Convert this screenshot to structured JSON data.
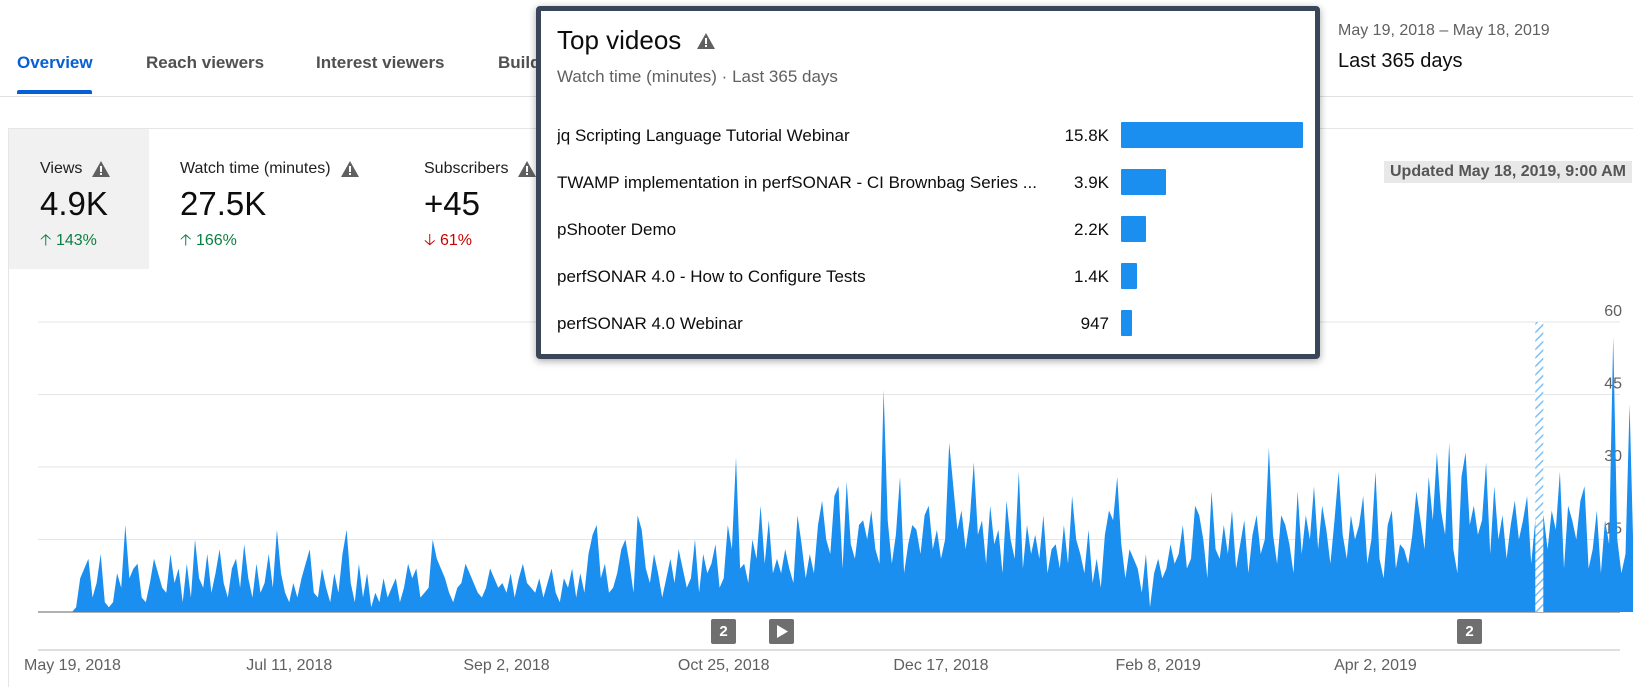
{
  "tabs": [
    {
      "label": "Overview",
      "active": true
    },
    {
      "label": "Reach viewers",
      "active": false
    },
    {
      "label": "Interest viewers",
      "active": false
    },
    {
      "label": "Build",
      "active": false
    }
  ],
  "date": {
    "range": "May 19, 2018 – May 18, 2019",
    "preset": "Last 365 days"
  },
  "metrics": [
    {
      "label": "Views",
      "value": "4.9K",
      "change": "143%",
      "direction": "up",
      "warning": true
    },
    {
      "label": "Watch time (minutes)",
      "value": "27.5K",
      "change": "166%",
      "direction": "up",
      "warning": true
    },
    {
      "label": "Subscribers",
      "value": "+45",
      "change": "61%",
      "direction": "down",
      "warning": true
    }
  ],
  "updated": "Updated May 18, 2019, 9:00 AM",
  "markers": [
    "2",
    "2"
  ],
  "top_videos": {
    "title": "Top videos",
    "subtitle": "Watch time (minutes) · Last 365 days",
    "items": [
      {
        "title": "jq Scripting Language Tutorial Webinar",
        "value_label": "15.8K",
        "value": 15800
      },
      {
        "title": "TWAMP implementation in perfSONAR - CI Brownbag Series ...",
        "value_label": "3.9K",
        "value": 3900
      },
      {
        "title": "pShooter Demo",
        "value_label": "2.2K",
        "value": 2200
      },
      {
        "title": "perfSONAR 4.0 - How to Configure Tests",
        "value_label": "1.4K",
        "value": 1400
      },
      {
        "title": "perfSONAR 4.0 Webinar",
        "value_label": "947",
        "value": 947
      }
    ]
  },
  "colors": {
    "accent": "#065fd4",
    "area": "#1a8ff0",
    "up": "#0b8043",
    "down": "#cc0000",
    "popup_border": "#394558"
  },
  "chart_data": {
    "type": "area",
    "ylim": [
      0,
      60
    ],
    "yticks": [
      0,
      15,
      30,
      45,
      60
    ],
    "x_tick_labels": [
      "May 19, 2018",
      "Jul 11, 2018",
      "Sep 2, 2018",
      "Oct 25, 2018",
      "Dec 17, 2018",
      "Feb 8, 2019",
      "Apr 2, 2019"
    ],
    "x_tick_days": [
      0,
      53,
      106,
      159,
      212,
      265,
      318
    ],
    "grid": true,
    "series": [
      {
        "values": [
          0,
          1,
          7,
          9,
          11,
          3,
          6,
          12,
          2,
          1,
          2,
          8,
          5,
          18,
          7,
          9,
          10,
          3,
          2,
          6,
          11,
          8,
          5,
          4,
          12,
          6,
          9,
          2,
          10,
          3,
          15,
          7,
          5,
          12,
          4,
          8,
          13,
          6,
          3,
          9,
          11,
          5,
          14,
          7,
          3,
          10,
          4,
          6,
          12,
          5,
          17,
          8,
          4,
          2,
          6,
          3,
          7,
          10,
          13,
          4,
          3,
          9,
          5,
          2,
          8,
          4,
          12,
          17,
          6,
          2,
          10,
          3,
          8,
          1,
          4,
          2,
          7,
          3,
          5,
          7,
          2,
          5,
          10,
          7,
          9,
          3,
          4,
          5,
          15,
          11,
          9,
          7,
          4,
          2,
          5,
          6,
          10,
          8,
          6,
          4,
          3,
          5,
          9,
          7,
          5,
          6,
          4,
          8,
          3,
          7,
          10,
          6,
          5,
          4,
          7,
          3,
          6,
          9,
          4,
          2,
          7,
          5,
          9,
          3,
          8,
          4,
          12,
          16,
          18,
          7,
          10,
          4,
          5,
          8,
          13,
          15,
          10,
          4,
          20,
          17,
          9,
          6,
          12,
          8,
          3,
          7,
          11,
          6,
          13,
          9,
          5,
          7,
          15,
          4,
          12,
          8,
          10,
          14,
          5,
          7,
          18,
          13,
          32,
          9,
          10,
          6,
          15,
          11,
          22,
          10,
          19,
          8,
          11,
          8,
          13,
          9,
          6,
          20,
          14,
          7,
          12,
          8,
          18,
          23,
          15,
          12,
          24,
          26,
          9,
          27,
          14,
          11,
          18,
          19,
          15,
          21,
          13,
          10,
          46,
          19,
          10,
          16,
          28,
          8,
          14,
          18,
          17,
          12,
          20,
          22,
          13,
          17,
          11,
          15,
          35,
          26,
          17,
          21,
          13,
          19,
          31,
          16,
          19,
          10,
          22,
          14,
          17,
          8,
          23,
          15,
          11,
          29,
          9,
          18,
          12,
          16,
          11,
          20,
          8,
          13,
          14,
          9,
          18,
          10,
          24,
          15,
          12,
          8,
          17,
          6,
          11,
          5,
          16,
          21,
          19,
          28,
          14,
          7,
          13,
          11,
          9,
          4,
          12,
          1,
          8,
          11,
          7,
          9,
          14,
          10,
          12,
          18,
          9,
          11,
          22,
          20,
          15,
          7,
          25,
          13,
          11,
          18,
          12,
          21,
          9,
          14,
          19,
          8,
          16,
          20,
          12,
          15,
          34,
          16,
          10,
          20,
          18,
          14,
          8,
          25,
          12,
          20,
          15,
          26,
          13,
          22,
          17,
          10,
          19,
          29,
          16,
          11,
          20,
          15,
          18,
          24,
          10,
          15,
          29,
          11,
          7,
          18,
          21,
          9,
          14,
          13,
          10,
          16,
          25,
          19,
          13,
          28,
          19,
          33,
          21,
          16,
          35,
          13,
          8,
          28,
          33,
          18,
          22,
          16,
          19,
          31,
          12,
          26,
          15,
          20,
          11,
          18,
          23,
          15,
          19,
          24,
          10,
          19,
          18,
          20,
          13,
          21,
          17,
          29,
          9,
          22,
          19,
          15,
          23,
          26,
          9,
          13,
          21,
          8,
          19,
          14,
          57,
          15,
          8,
          12,
          43,
          10,
          7,
          24,
          12,
          9,
          5,
          28,
          13,
          7,
          35,
          28,
          25,
          8
        ]
      }
    ]
  }
}
